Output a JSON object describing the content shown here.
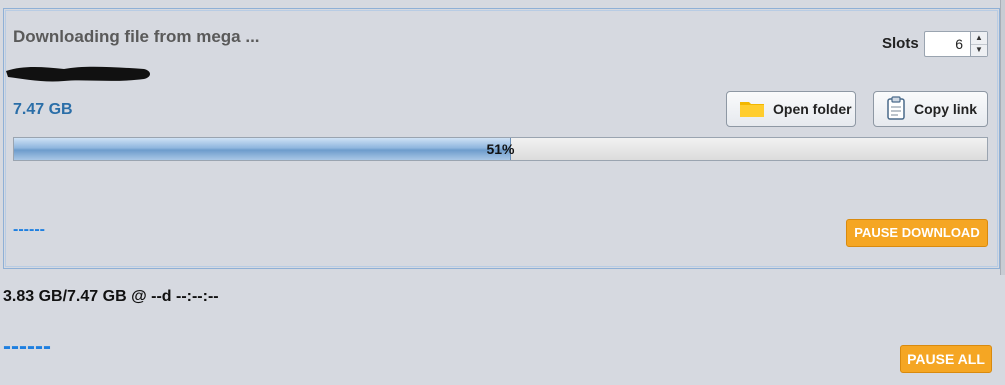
{
  "panel": {
    "title": "Downloading file from mega  ...",
    "file_size": "7.47 GB",
    "slots_label": "Slots",
    "slots_value": "6",
    "open_folder_label": "Open folder",
    "copy_link_label": "Copy link",
    "progress_percent": 51,
    "progress_text": "51%",
    "speed_placeholder": "------",
    "pause_download_label": "PAUSE DOWNLOAD",
    "icons": {
      "open_folder": "folder-icon",
      "copy_link": "clipboard-icon",
      "slots_up": "spin-up-icon",
      "slots_down": "spin-down-icon"
    }
  },
  "global": {
    "status_text": "3.83 GB/7.47 GB @ --d --:--:--",
    "speed_placeholder": "------",
    "pause_all_label": "PAUSE ALL"
  },
  "colors": {
    "accent_orange": "#f5a623",
    "link_blue": "#2a6ea8",
    "dash_blue": "#1e7fe0"
  }
}
